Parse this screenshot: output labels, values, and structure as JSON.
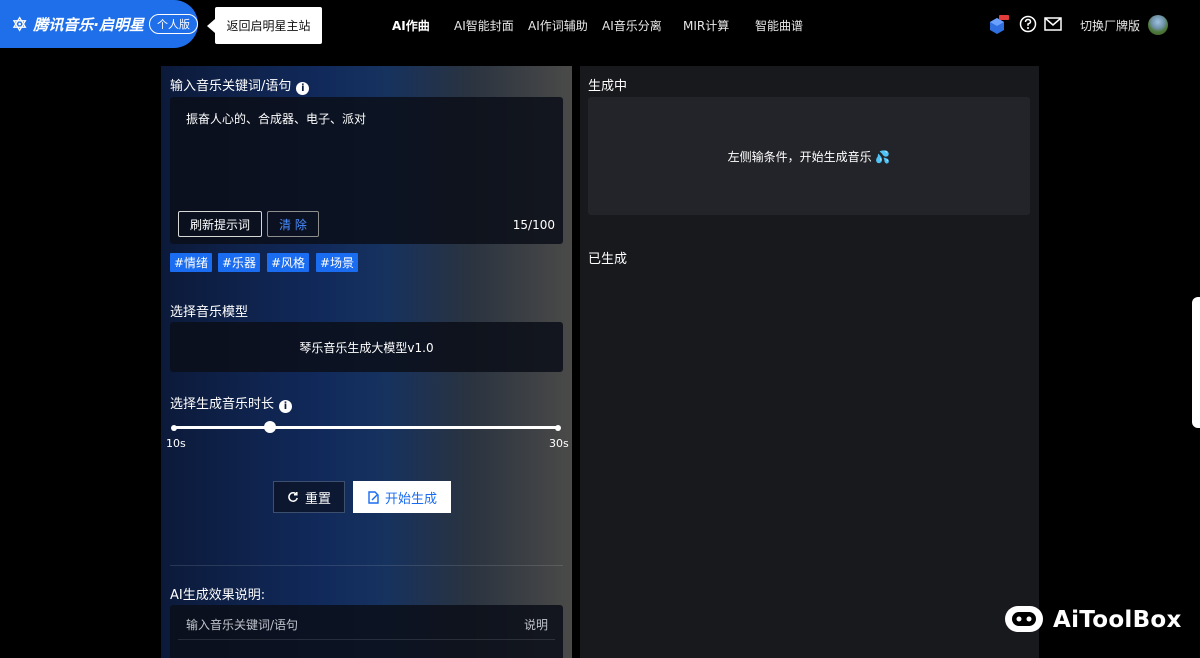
{
  "header": {
    "brand_name": "腾讯音乐·启明星",
    "brand_badge": "个人版",
    "back_link": "返回启明星主站",
    "nav": [
      "AI作曲",
      "AI智能封面",
      "AI作词辅助",
      "AI音乐分离",
      "MIR计算",
      "智能曲谱"
    ],
    "active_nav": "AI作曲",
    "switch_label": "切换厂牌版",
    "icons": [
      "cube-badge-icon",
      "help-icon",
      "mail-icon",
      "avatar"
    ]
  },
  "form": {
    "keyword_label": "输入音乐关键词/语句",
    "keyword_value": "振奋人心的、合成器、电子、派对",
    "refresh_button": "刷新提示词",
    "clear_button": "清 除",
    "counter": "15/100",
    "tags": [
      "#情绪",
      "#乐器",
      "#风格",
      "#场景"
    ],
    "model_label": "选择音乐模型",
    "model_value": "琴乐音乐生成大模型v1.0",
    "duration_label": "选择生成音乐时长",
    "duration_min": "10s",
    "duration_max": "30s",
    "duration_fraction": 0.25,
    "reset_button": "重置",
    "start_button": "开始生成",
    "effect_label": "AI生成效果说明:",
    "table_headers": [
      "输入音乐关键词/语句",
      "说明"
    ]
  },
  "results": {
    "generating_label": "生成中",
    "empty_hint": "左侧输条件，开始生成音乐 💦",
    "generated_label": "已生成"
  },
  "watermark": {
    "text": "AiToolBox"
  },
  "colors": {
    "brand": "#1f6feb",
    "tag": "#1a6cf0",
    "start_text": "#1a6cf0",
    "right_panel": "#18191d"
  }
}
